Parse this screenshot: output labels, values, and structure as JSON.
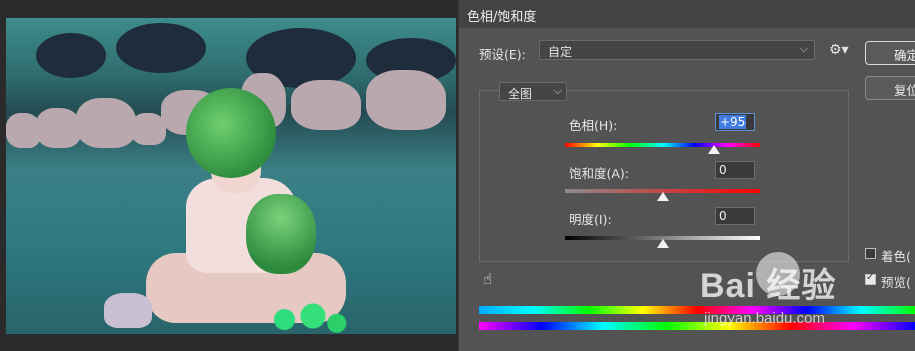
{
  "dialog": {
    "title": "色相/饱和度",
    "preset_label": "预设(E):",
    "preset_value": "自定",
    "ok_label": "确定",
    "reset_label": "复位",
    "edit_value": "全图",
    "hue": {
      "label": "色相(H):",
      "value": "+95",
      "level": 95
    },
    "saturation": {
      "label": "饱和度(A):",
      "value": "0",
      "level": 0
    },
    "lightness": {
      "label": "明度(I):",
      "value": "0",
      "level": 0
    },
    "colorize_label": "着色(",
    "colorize_checked": false,
    "preview_label": "预览(",
    "preview_checked": true
  },
  "icons": {
    "gear": "gear-icon",
    "chevron": "chevron-down-icon",
    "hand": "hand-target-icon"
  },
  "watermark": {
    "brand": "Bai 经验",
    "site": "jingyan.baidu.com"
  },
  "colors": {
    "dialog_bg": "#535353",
    "titlebar_bg": "#434343",
    "highlight": "#3f7be0"
  }
}
